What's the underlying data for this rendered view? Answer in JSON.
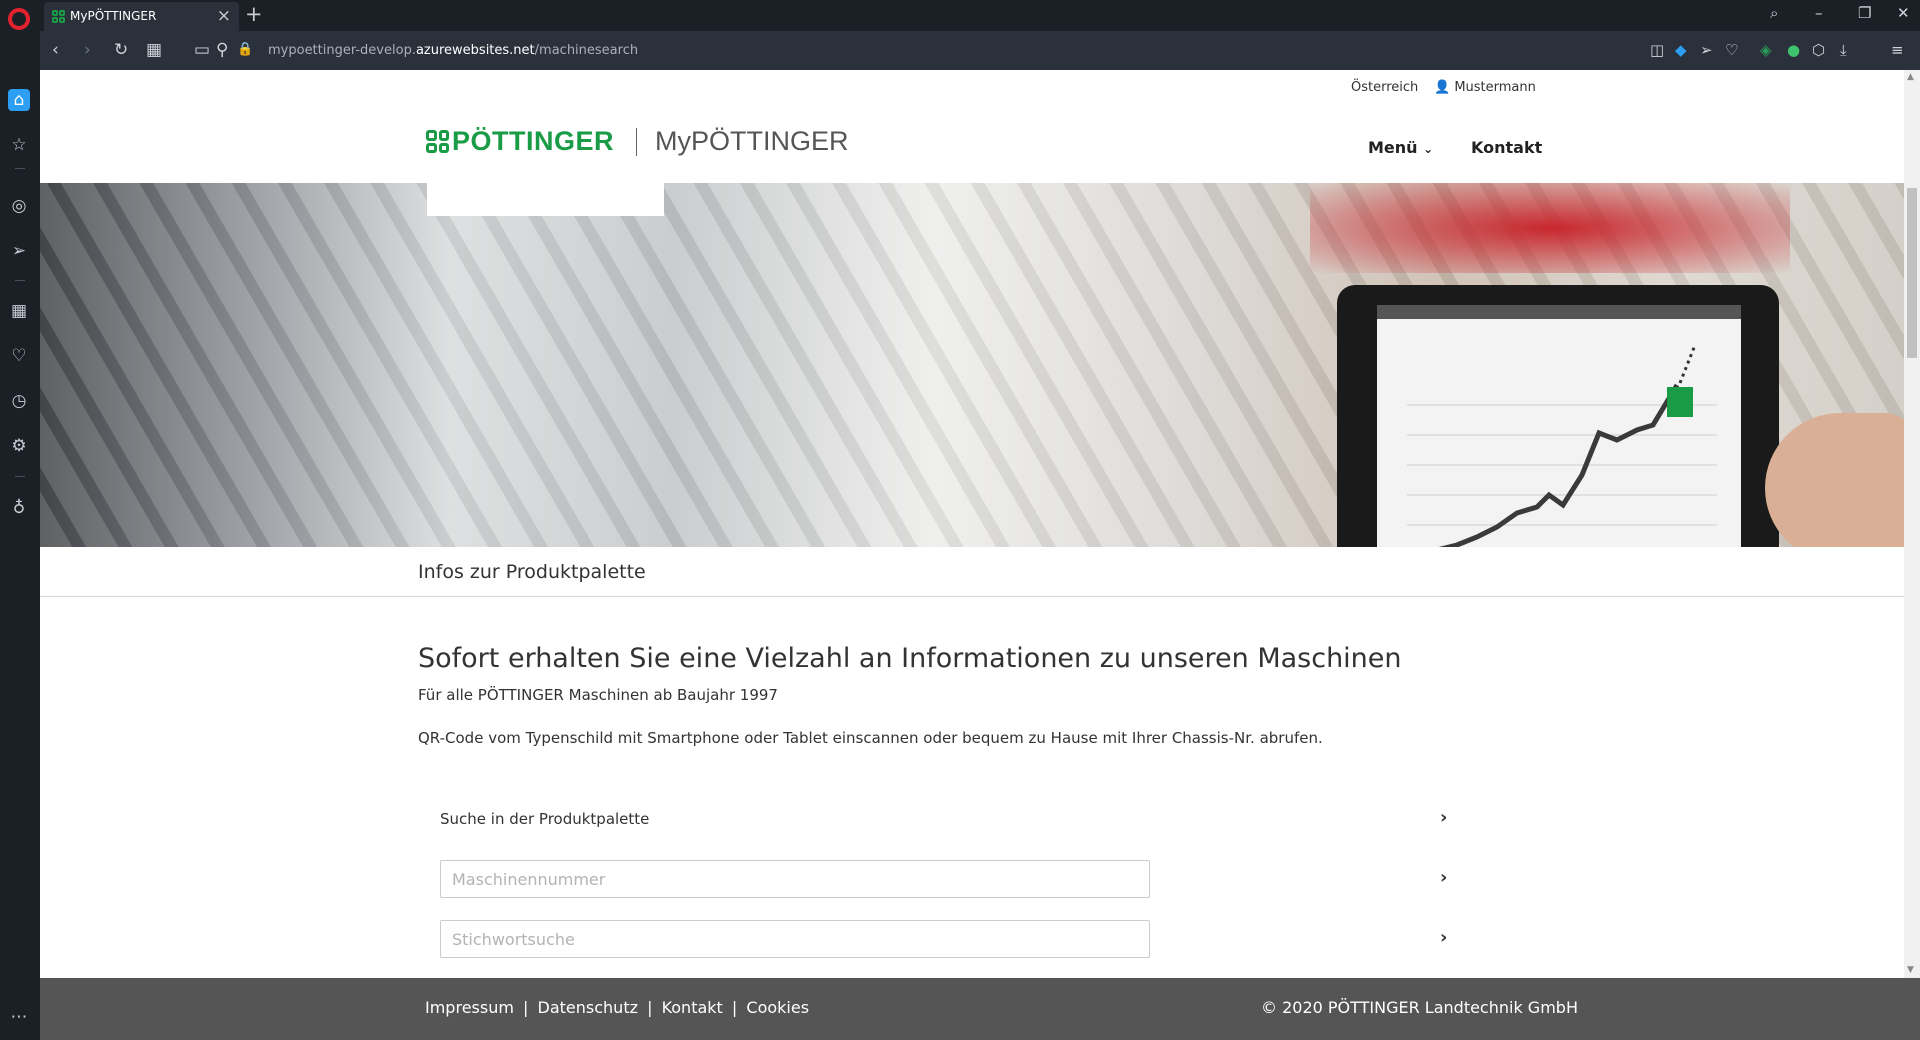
{
  "browser": {
    "tab_title": "MyPÖTTINGER",
    "url_prefix": "mypoettinger-develop.",
    "url_domain": "azurewebsites.net",
    "url_path": "/machinesearch"
  },
  "site": {
    "top_meta": {
      "country": "Österreich",
      "user": "Mustermann"
    },
    "logo": {
      "brand": "PÖTTINGER",
      "product": "MyPÖTTINGER",
      "brand_color": "#1a9c47"
    },
    "nav": {
      "menu": "Menü",
      "contact": "Kontakt"
    },
    "subnav_title": "Infos zur Produktpalette",
    "headline": "Sofort erhalten Sie eine Vielzahl an Informationen zu unseren Maschinen",
    "subline": "Für alle PÖTTINGER Maschinen ab Baujahr 1997",
    "description": "QR-Code vom Typenschild mit Smartphone oder Tablet einscannen oder bequem zu Hause mit Ihrer Chassis-Nr. abrufen.",
    "search": {
      "product_range_label": "Suche in der Produktpalette",
      "machine_number_placeholder": "Maschinennummer",
      "machine_number_value": "",
      "keyword_placeholder": "Stichwortsuche",
      "keyword_value": ""
    },
    "footer": {
      "links": [
        "Impressum",
        "Datenschutz",
        "Kontakt",
        "Cookies"
      ],
      "separator": "|",
      "copyright": "© 2020 PÖTTINGER Landtechnik GmbH"
    }
  }
}
